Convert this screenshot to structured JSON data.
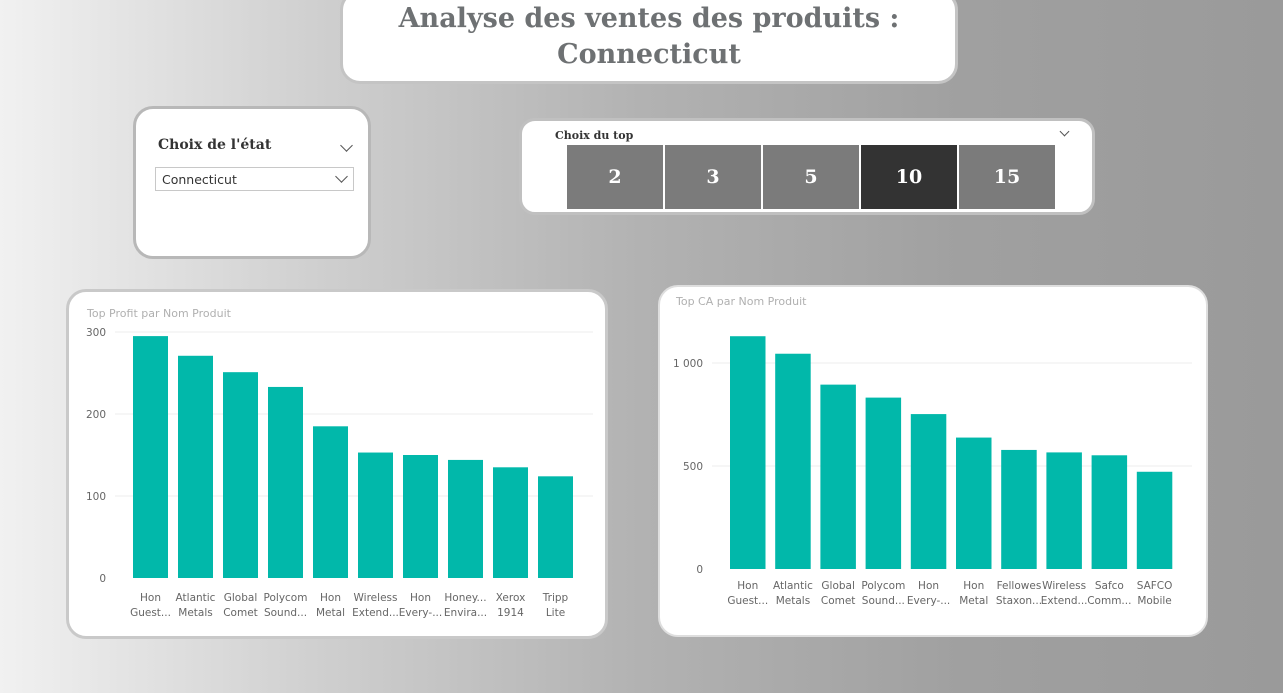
{
  "title": {
    "line1": "Analyse des ventes des produits :",
    "line2": "Connecticut"
  },
  "state_slicer": {
    "header": "Choix de l'état",
    "selected_value": "Connecticut"
  },
  "top_slicer": {
    "header": "Choix du top",
    "options": [
      "2",
      "3",
      "5",
      "10",
      "15"
    ],
    "selected": "10"
  },
  "colors": {
    "bar": "#01B8AA",
    "tile": "#7B7B7B",
    "tile_selected": "#333333"
  },
  "chart_data": [
    {
      "type": "bar",
      "title": "Top Profit par Nom Produit",
      "categories": [
        [
          "Hon",
          "Guest..."
        ],
        [
          "Atlantic",
          "Metals"
        ],
        [
          "Global",
          "Comet"
        ],
        [
          "Polycom",
          "Sound..."
        ],
        [
          "Hon",
          "Metal"
        ],
        [
          "Wireless",
          "Extend..."
        ],
        [
          "Hon",
          "Every-..."
        ],
        [
          "Honey...",
          "Envira..."
        ],
        [
          "Xerox",
          "1914"
        ],
        [
          "Tripp",
          "Lite"
        ]
      ],
      "values": [
        295,
        271,
        251,
        233,
        185,
        153,
        150,
        144,
        135,
        124
      ],
      "ylim": [
        0,
        300
      ],
      "yticks": [
        0,
        100,
        200,
        300
      ],
      "ytick_labels": [
        "0",
        "100",
        "200",
        "300"
      ],
      "grid": true
    },
    {
      "type": "bar",
      "title": "Top CA par Nom Produit",
      "categories": [
        [
          "Hon",
          "Guest..."
        ],
        [
          "Atlantic",
          "Metals"
        ],
        [
          "Global",
          "Comet"
        ],
        [
          "Polycom",
          "Sound..."
        ],
        [
          "Hon",
          "Every-..."
        ],
        [
          "Hon",
          "Metal"
        ],
        [
          "Fellowes",
          "Staxon..."
        ],
        [
          "Wireless",
          "Extend..."
        ],
        [
          "Safco",
          "Comm..."
        ],
        [
          "SAFCO",
          "Mobile"
        ]
      ],
      "values": [
        1130,
        1045,
        895,
        832,
        752,
        638,
        578,
        566,
        552,
        472
      ],
      "ylim": [
        0,
        1000
      ],
      "yticks": [
        0,
        500,
        1000
      ],
      "ytick_labels": [
        "0",
        "500",
        "1 000"
      ],
      "grid": true
    }
  ]
}
